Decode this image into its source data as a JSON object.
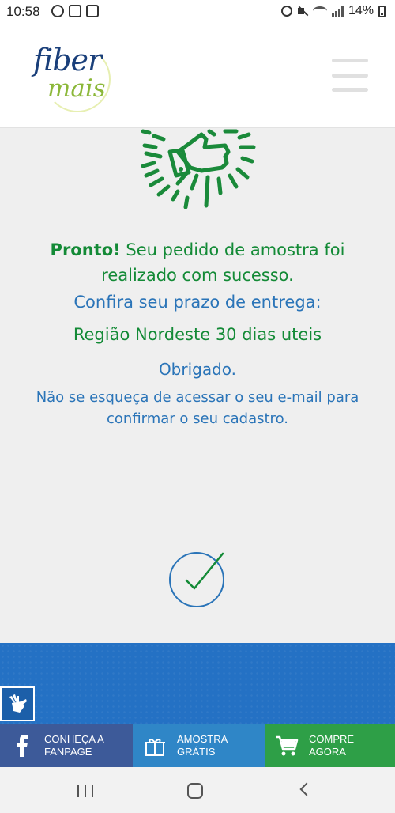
{
  "status_bar": {
    "time": "10:58",
    "battery": "14%",
    "icons": [
      "whatsapp-icon",
      "mail-icon",
      "vpn-icon",
      "alarm-icon",
      "mute-icon",
      "wifi-icon",
      "signal-icon",
      "battery-icon"
    ]
  },
  "header": {
    "logo_line1": "fiber",
    "logo_line2": "mais",
    "menu_icon": "hamburger-menu-icon",
    "colors": {
      "logo_blue": "#1a3f7a",
      "logo_green": "#8cb83a"
    }
  },
  "message": {
    "strong": "Pronto!",
    "line1_rest": " Seu pedido de amostra foi",
    "line2": "realizado com sucesso.",
    "line3": "Confira seu prazo de entrega:",
    "line4": "Região Nordeste 30 dias uteis",
    "line5": "Obrigado.",
    "line6": "Não se esqueça de acessar o seu e-mail para",
    "line7": "confirmar o seu cadastro.",
    "colors": {
      "green": "#138a36",
      "blue": "#2a74b8"
    }
  },
  "footer_actions": [
    {
      "line1": "CONHEÇA A",
      "line2": "FANPAGE",
      "icon": "facebook-icon",
      "color": "#3d5a99"
    },
    {
      "line1": "AMOSTRA",
      "line2": "GRÁTIS",
      "icon": "gift-icon",
      "color": "#2f86c7"
    },
    {
      "line1": "COMPRE",
      "line2": "AGORA",
      "icon": "cart-icon",
      "color": "#2e9f47"
    }
  ],
  "accessibility_icon": "sign-language-icon",
  "nav_bar": [
    "recent-apps-icon",
    "home-icon",
    "back-icon"
  ]
}
